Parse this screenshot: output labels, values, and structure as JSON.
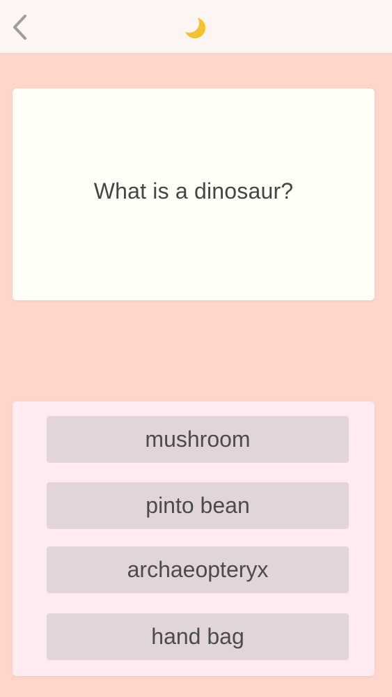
{
  "header": {
    "back_icon": "chevron-left-icon",
    "mode_icon": "crescent-moon-icon"
  },
  "question": {
    "text": "What is a dinosaur?"
  },
  "answers": [
    {
      "label": "mushroom"
    },
    {
      "label": "pinto bean"
    },
    {
      "label": "archaeopteryx"
    },
    {
      "label": "hand bag"
    }
  ],
  "colors": {
    "background": "#ffd5cc",
    "header_bg": "#fcf5f2",
    "card_bg": "#fffef7",
    "panel_bg": "#fdebf0",
    "answer_bg": "#e2d5da",
    "moon": "#f2c230"
  }
}
